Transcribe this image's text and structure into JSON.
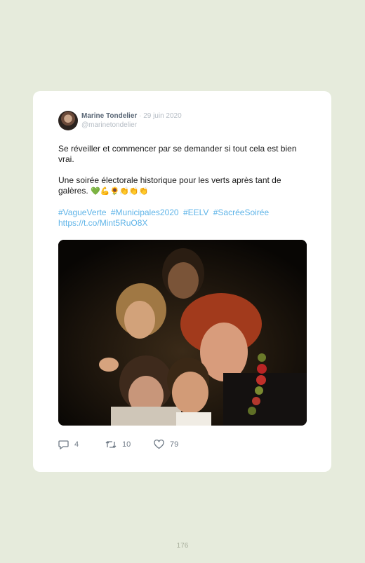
{
  "tweet": {
    "author_name": "Marine Tondelier",
    "separator": "·",
    "date": "29 juin 2020",
    "handle": "@marinetondelier",
    "paragraph1": "Se réveiller et commencer par se demander si tout cela est bien vrai.",
    "paragraph2": "Une soirée électorale historique pour les verts après tant de galères.",
    "emojis": "💚💪🌻👏👏👏",
    "hashtags": [
      "#VagueVerte",
      "#Municipales2020",
      "#EELV",
      "#SacréeSoirée"
    ],
    "link": "https://t.co/Mint5RuO8X",
    "actions": {
      "replies": "4",
      "retweets": "10",
      "likes": "79"
    },
    "icons": {
      "reply": "reply-icon",
      "retweet": "retweet-icon",
      "like": "heart-icon"
    }
  },
  "page": {
    "number": "176"
  },
  "colors": {
    "background": "#e6ebdc",
    "card": "#ffffff",
    "link": "#5fb4e8",
    "meta": "#b5bcc4"
  }
}
